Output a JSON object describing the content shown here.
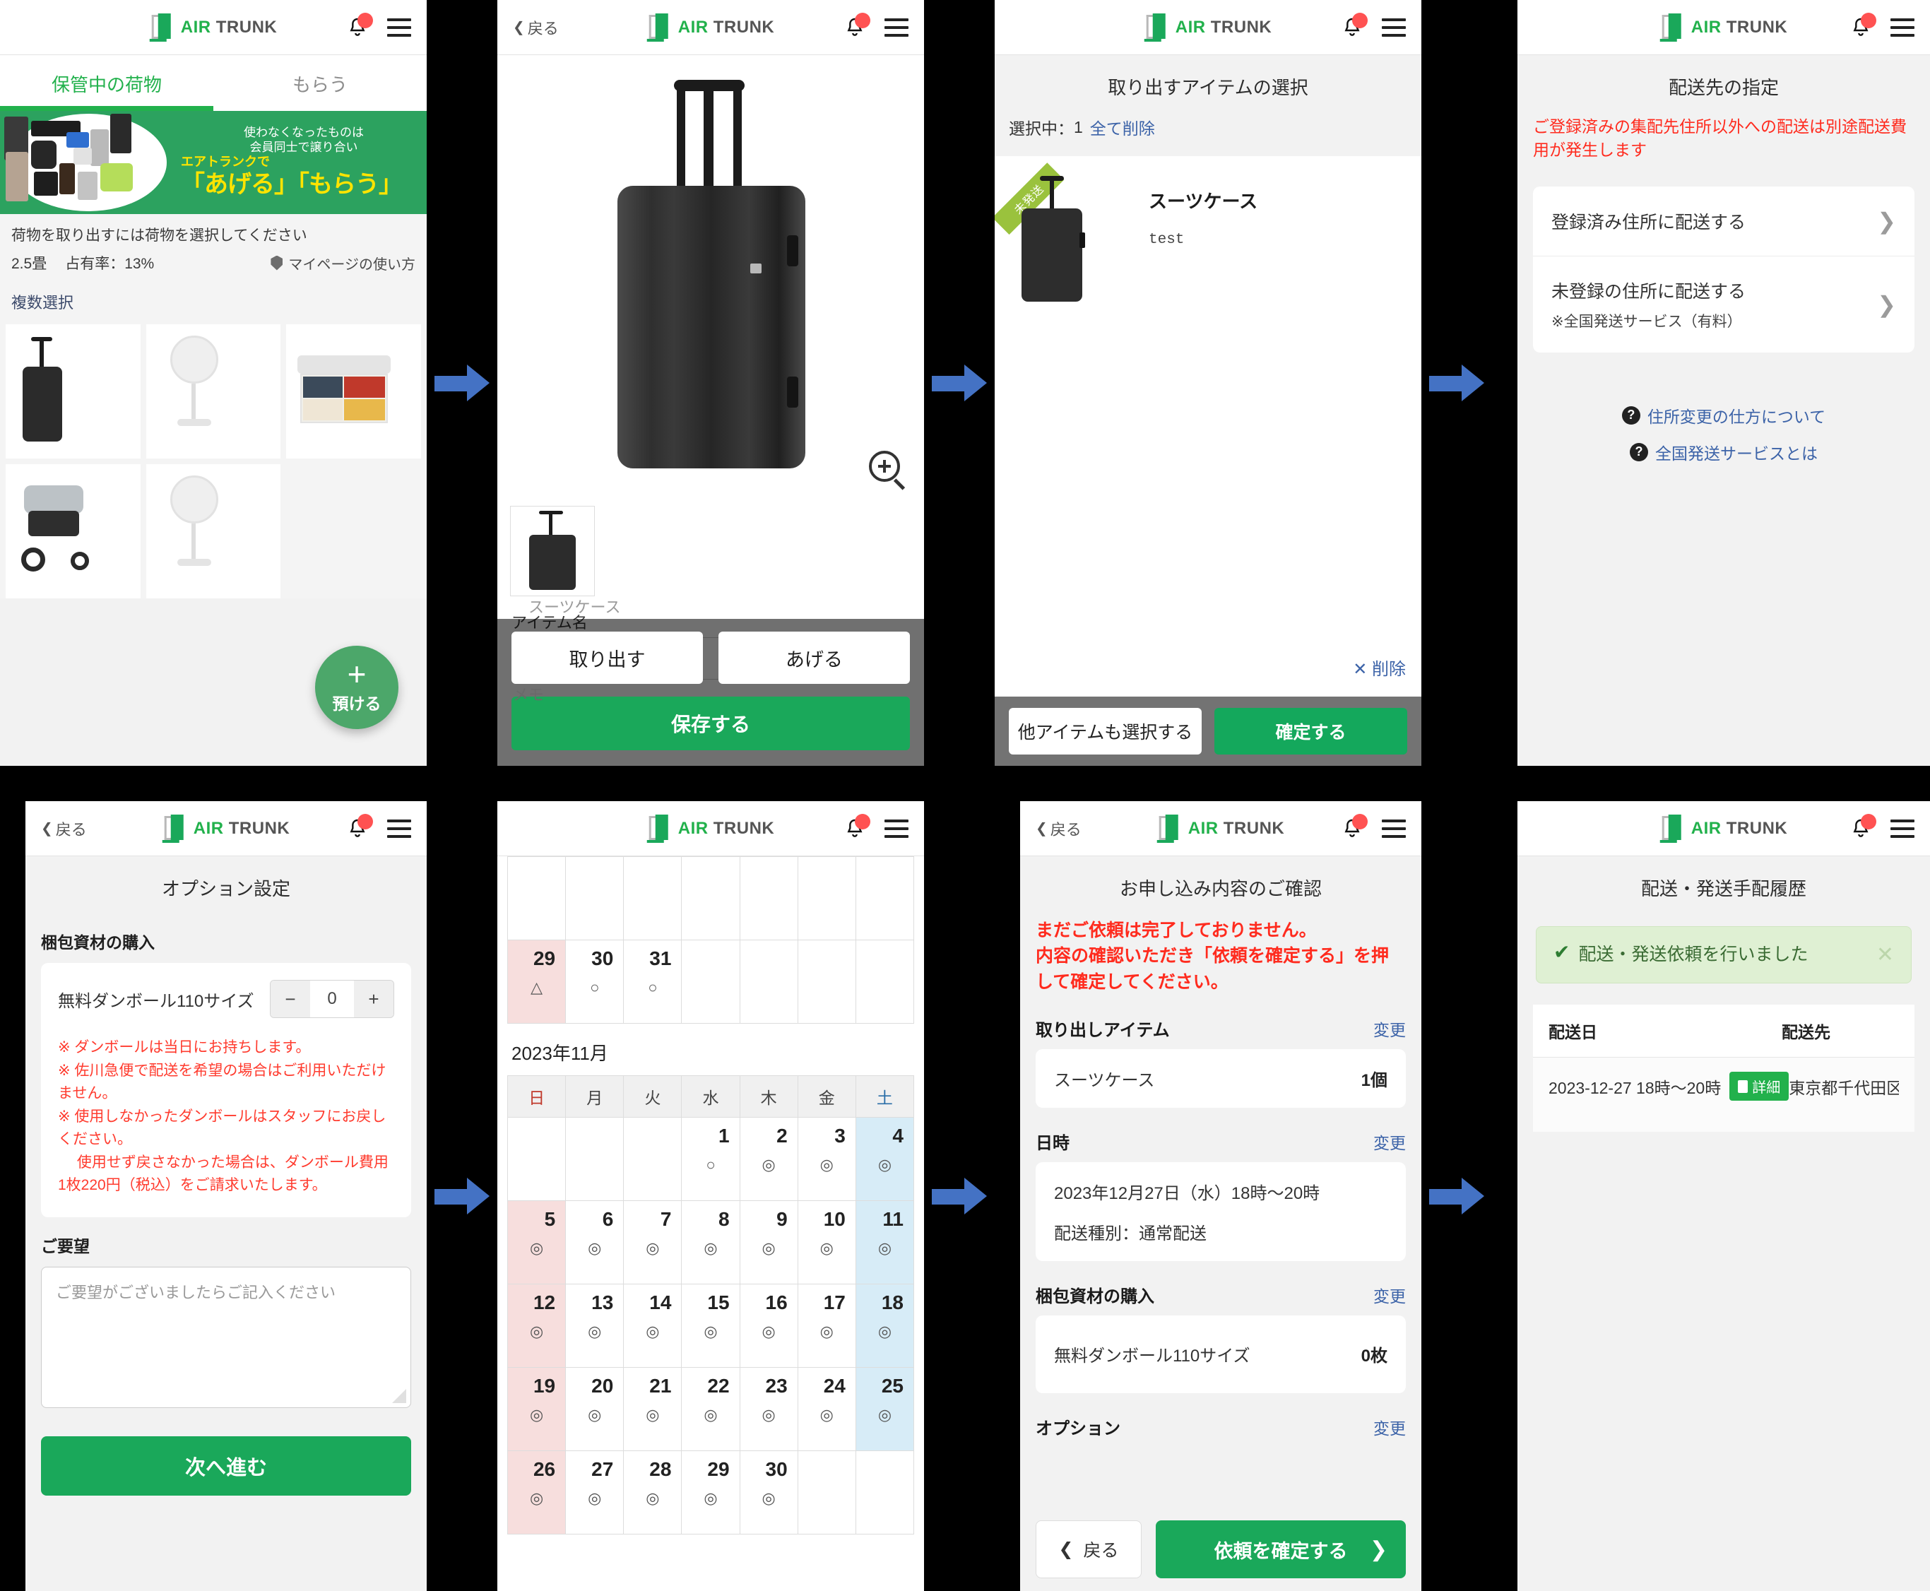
{
  "brand": {
    "air": "AIR",
    "trunk": "TRUNK",
    "logo_color": "#22b14c"
  },
  "common": {
    "back_label": "戻る",
    "bell_icon": "bell-icon",
    "menu_icon": "hamburger-menu-icon",
    "chevron_right": "›"
  },
  "panel1": {
    "tabs": [
      {
        "label": "保管中の荷物",
        "active": true
      },
      {
        "label": "もらう",
        "active": false
      }
    ],
    "banner": {
      "line1": "使わなくなったものは",
      "line2": "会員同士で譲り合い",
      "line3": "エアトランクで",
      "line4": "「あげる」「もらう」"
    },
    "notice": "荷物を取り出すには荷物を選択してください",
    "size": "2.5畳",
    "occupancy": "占有率：13%",
    "howto": "マイページの使い方",
    "multi_select": "複数選択",
    "fab": {
      "plus": "+",
      "label": "預ける"
    },
    "thumbnails": [
      "suitcase",
      "fan",
      "storage-box",
      "stroller",
      "fan2",
      "empty"
    ]
  },
  "panel2": {
    "back": "戻る",
    "item_name_label": "アイテム名",
    "item_name_value": "スーツケース",
    "memo_label": "メモ",
    "buttons": {
      "takeout": "取り出す",
      "giveaway": "あげる",
      "save": "保存する"
    },
    "zoom_icon": "zoom-in-icon"
  },
  "panel3": {
    "title": "取り出すアイテムの選択",
    "selecting_label": "選択中：",
    "selecting_count": "1",
    "delete_all": "全て削除",
    "item": {
      "ribbon": "未発送",
      "name": "スーツケース",
      "memo": "test"
    },
    "delete_link": "✕ 削除",
    "footer": {
      "other_items": "他アイテムも選択する",
      "confirm": "確定する"
    }
  },
  "panel4": {
    "title": "配送先の指定",
    "warning": "ご登録済みの集配先住所以外への配送は別途配送費用が発生します",
    "options": [
      {
        "label": "登録済み住所に配送する",
        "sub": ""
      },
      {
        "label": "未登録の住所に配送する",
        "sub": "※全国発送サービス（有料）"
      }
    ],
    "help": [
      "住所変更の仕方について",
      "全国発送サービスとは"
    ]
  },
  "panel5": {
    "title": "オプション設定",
    "section_packing": "梱包資材の購入",
    "cardboard": {
      "name": "無料ダンボール110サイズ",
      "minus": "−",
      "value": "0",
      "plus": "+"
    },
    "notes": "※ ダンボールは当日にお持ちします。\n※ 佐川急便で配送を希望の場合はご利用いただけません。\n※ 使用しなかったダンボールはスタッフにお戻しください。\n　 使用せず戻さなかった場合は、ダンボール費用1枚220円（税込）をご請求いたします。",
    "section_request": "ご要望",
    "request_placeholder": "ご要望がございましたらご記入ください",
    "next": "次へ進む"
  },
  "panel6": {
    "weekdays": [
      "日",
      "月",
      "火",
      "水",
      "木",
      "金",
      "土"
    ],
    "month_label": "2023年11月",
    "prev_month_tail": [
      {
        "d": "29",
        "mark": "△",
        "type": "sun"
      },
      {
        "d": "30",
        "mark": "○",
        "type": ""
      },
      {
        "d": "31",
        "mark": "○",
        "type": ""
      },
      {
        "d": "",
        "mark": "",
        "type": "empty"
      },
      {
        "d": "",
        "mark": "",
        "type": "empty"
      },
      {
        "d": "",
        "mark": "",
        "type": "empty"
      },
      {
        "d": "",
        "mark": "",
        "type": "empty"
      }
    ],
    "weeks": [
      [
        {
          "d": "",
          "mark": "",
          "type": "empty"
        },
        {
          "d": "",
          "mark": "",
          "type": "empty"
        },
        {
          "d": "",
          "mark": "",
          "type": "empty"
        },
        {
          "d": "1",
          "mark": "○",
          "type": ""
        },
        {
          "d": "2",
          "mark": "◎",
          "type": ""
        },
        {
          "d": "3",
          "mark": "◎",
          "type": ""
        },
        {
          "d": "4",
          "mark": "◎",
          "type": "sat"
        }
      ],
      [
        {
          "d": "5",
          "mark": "◎",
          "type": "sun"
        },
        {
          "d": "6",
          "mark": "◎",
          "type": ""
        },
        {
          "d": "7",
          "mark": "◎",
          "type": ""
        },
        {
          "d": "8",
          "mark": "◎",
          "type": ""
        },
        {
          "d": "9",
          "mark": "◎",
          "type": ""
        },
        {
          "d": "10",
          "mark": "◎",
          "type": ""
        },
        {
          "d": "11",
          "mark": "◎",
          "type": "sat"
        }
      ],
      [
        {
          "d": "12",
          "mark": "◎",
          "type": "sun"
        },
        {
          "d": "13",
          "mark": "◎",
          "type": ""
        },
        {
          "d": "14",
          "mark": "◎",
          "type": ""
        },
        {
          "d": "15",
          "mark": "◎",
          "type": ""
        },
        {
          "d": "16",
          "mark": "◎",
          "type": ""
        },
        {
          "d": "17",
          "mark": "◎",
          "type": ""
        },
        {
          "d": "18",
          "mark": "◎",
          "type": "sat"
        }
      ],
      [
        {
          "d": "19",
          "mark": "◎",
          "type": "sun"
        },
        {
          "d": "20",
          "mark": "◎",
          "type": ""
        },
        {
          "d": "21",
          "mark": "◎",
          "type": ""
        },
        {
          "d": "22",
          "mark": "◎",
          "type": ""
        },
        {
          "d": "23",
          "mark": "◎",
          "type": ""
        },
        {
          "d": "24",
          "mark": "◎",
          "type": ""
        },
        {
          "d": "25",
          "mark": "◎",
          "type": "sat"
        }
      ],
      [
        {
          "d": "26",
          "mark": "◎",
          "type": "sun"
        },
        {
          "d": "27",
          "mark": "◎",
          "type": ""
        },
        {
          "d": "28",
          "mark": "◎",
          "type": ""
        },
        {
          "d": "29",
          "mark": "◎",
          "type": ""
        },
        {
          "d": "30",
          "mark": "◎",
          "type": ""
        },
        {
          "d": "",
          "mark": "",
          "type": "empty"
        },
        {
          "d": "",
          "mark": "",
          "type": "empty"
        }
      ]
    ]
  },
  "panel7": {
    "title": "お申し込み内容のご確認",
    "warning": "まだご依頼は完了しておりません。\n内容の確認いただき「依頼を確定する」を押して確定してください。",
    "change_label": "変更",
    "sections": {
      "items_label": "取り出しアイテム",
      "item_name": "スーツケース",
      "item_qty": "1個",
      "datetime_label": "日時",
      "datetime_value": "2023年12月27日（水）18時〜20時",
      "delivery_type": "配送種別：通常配送",
      "packing_label": "梱包資材の購入",
      "packing_name": "無料ダンボール110サイズ",
      "packing_qty": "0枚",
      "option_label": "オプション"
    },
    "footer": {
      "back": "戻る",
      "confirm": "依頼を確定する"
    }
  },
  "panel8": {
    "title": "配送・発送手配履歴",
    "alert": "配送・発送依頼を行いました",
    "alert_close": "✕",
    "table": {
      "headers": [
        "配送日",
        "配送先"
      ],
      "rows": [
        {
          "date": "2023-12-27 18時〜20時",
          "detail_btn": "詳細",
          "dest": "東京都千代田区神"
        }
      ]
    }
  }
}
